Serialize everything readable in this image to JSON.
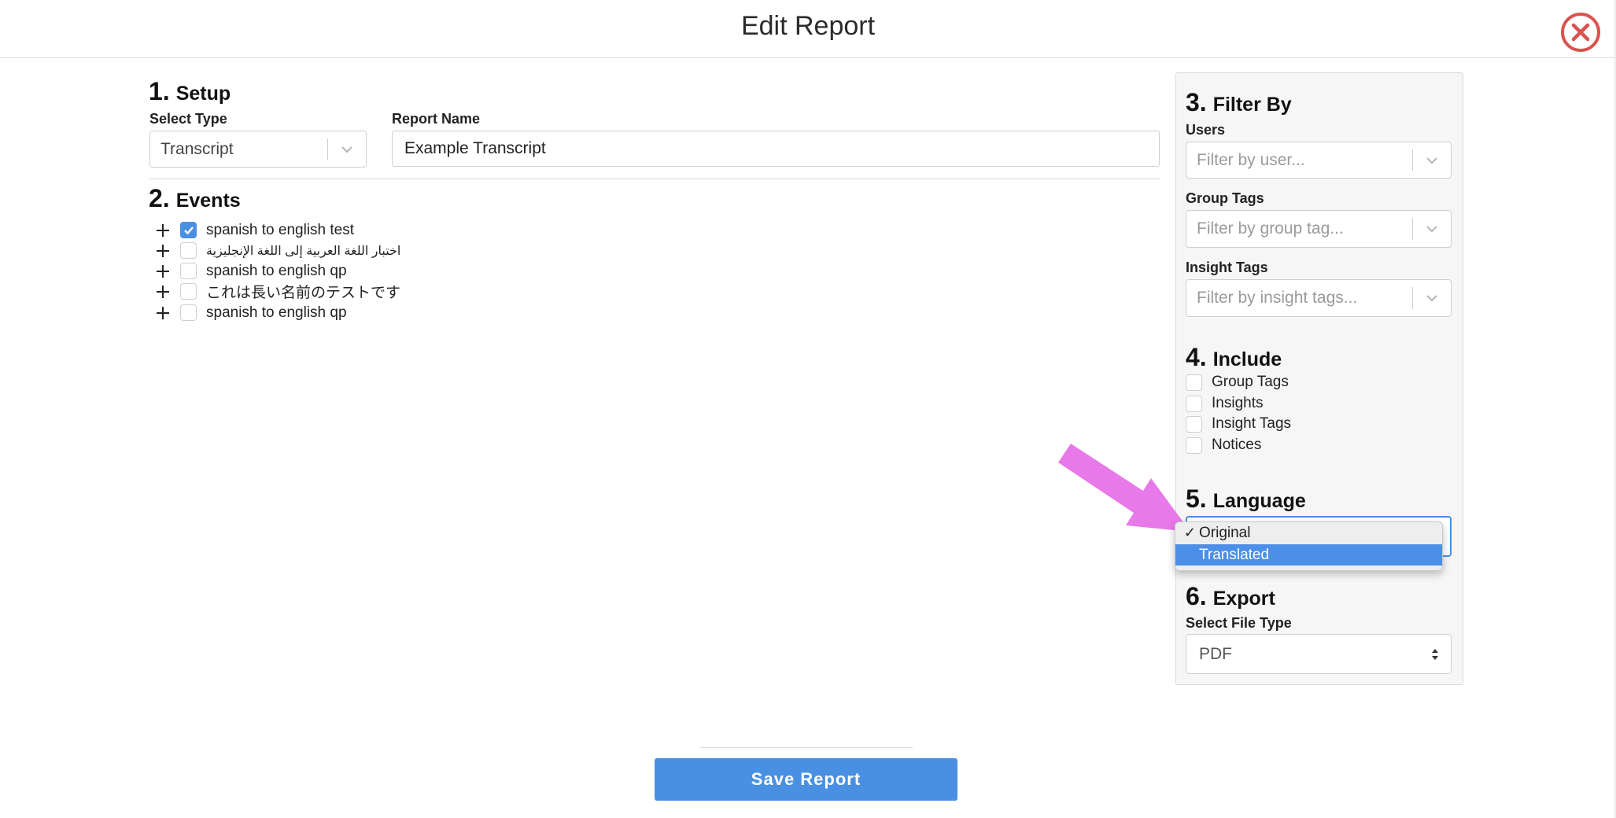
{
  "header": {
    "title": "Edit Report"
  },
  "setup": {
    "number": "1.",
    "heading": "Setup",
    "type_label": "Select Type",
    "type_value": "Transcript",
    "name_label": "Report Name",
    "name_value": "Example Transcript"
  },
  "events": {
    "number": "2.",
    "heading": "Events",
    "items": [
      {
        "label": "spanish to english test",
        "checked": true
      },
      {
        "label": "اختبار اللغة العربية إلى اللغة الإنجليزية",
        "checked": false
      },
      {
        "label": "spanish to english qp",
        "checked": false
      },
      {
        "label": "これは長い名前のテストです",
        "checked": false
      },
      {
        "label": "spanish to english qp",
        "checked": false
      }
    ]
  },
  "filter": {
    "number": "3.",
    "heading": "Filter By",
    "users_label": "Users",
    "users_placeholder": "Filter by user...",
    "group_tags_label": "Group Tags",
    "group_tags_placeholder": "Filter by group tag...",
    "insight_tags_label": "Insight Tags",
    "insight_tags_placeholder": "Filter by insight tags..."
  },
  "include": {
    "number": "4.",
    "heading": "Include",
    "items": [
      {
        "label": "Group Tags",
        "checked": false
      },
      {
        "label": "Insights",
        "checked": false
      },
      {
        "label": "Insight Tags",
        "checked": false
      },
      {
        "label": "Notices",
        "checked": false
      }
    ]
  },
  "language": {
    "number": "5.",
    "heading": "Language",
    "options": [
      {
        "label": "Original",
        "checkmark": "✓",
        "selected": true,
        "highlighted": false
      },
      {
        "label": "Translated",
        "checkmark": "",
        "selected": false,
        "highlighted": true
      }
    ]
  },
  "export": {
    "number": "6.",
    "heading": "Export",
    "file_type_label": "Select File Type",
    "file_type_value": "PDF"
  },
  "footer": {
    "save_label": "Save Report"
  },
  "colors": {
    "accent": "#4a90e2",
    "close_red": "#d9534f",
    "arrow_pink": "#e879e8",
    "dropdown_highlight": "#4c8fe8"
  }
}
